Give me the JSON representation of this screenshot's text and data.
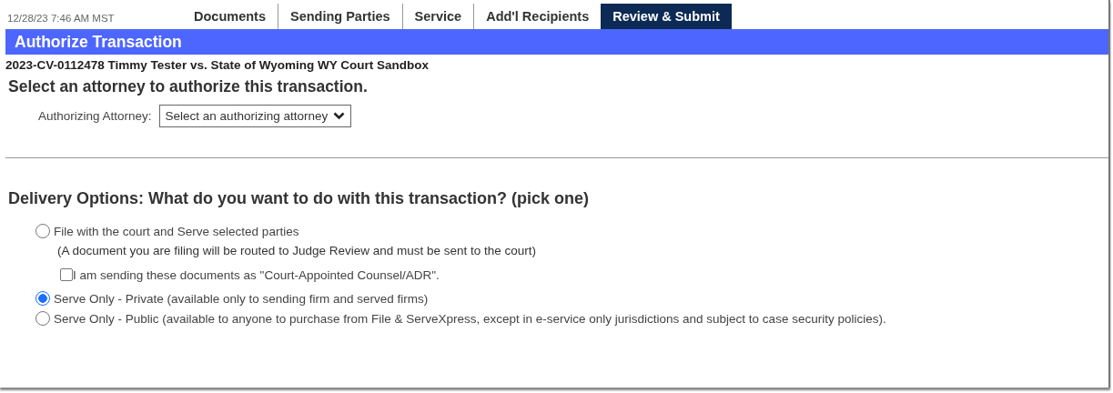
{
  "timestamp": "12/28/23 7:46 AM MST",
  "tabs": [
    {
      "label": "Documents",
      "selected": false
    },
    {
      "label": "Sending Parties",
      "selected": false
    },
    {
      "label": "Service",
      "selected": false
    },
    {
      "label": "Add'l Recipients",
      "selected": false
    },
    {
      "label": "Review & Submit",
      "selected": true
    }
  ],
  "title": "Authorize Transaction",
  "case_line": "2023-CV-0112478  Timmy Tester vs. State of Wyoming  WY Court Sandbox",
  "attorney_heading": "Select an attorney to authorize this transaction.",
  "attorney_field": {
    "label": "Authorizing Attorney:",
    "value": "Select an authorizing attorney"
  },
  "delivery_heading": "Delivery Options: What do you want to do with this transaction? (pick one)",
  "options": [
    {
      "kind": "radio",
      "label": "File with the court and Serve selected parties",
      "selected": false
    },
    {
      "kind": "note",
      "label": "(A document you are filing will be routed to Judge Review and must be sent to the court)"
    },
    {
      "kind": "checkbox",
      "label": "I am sending these documents as \"Court-Appointed Counsel/ADR\".",
      "checked": false
    },
    {
      "kind": "radio",
      "label": "Serve Only - Private (available only to sending firm and served firms)",
      "selected": true
    },
    {
      "kind": "radio",
      "label": "Serve Only - Public (available to anyone to purchase from File & ServeXpress, except in e-service only jurisdictions and subject to case security policies).",
      "selected": false
    }
  ]
}
